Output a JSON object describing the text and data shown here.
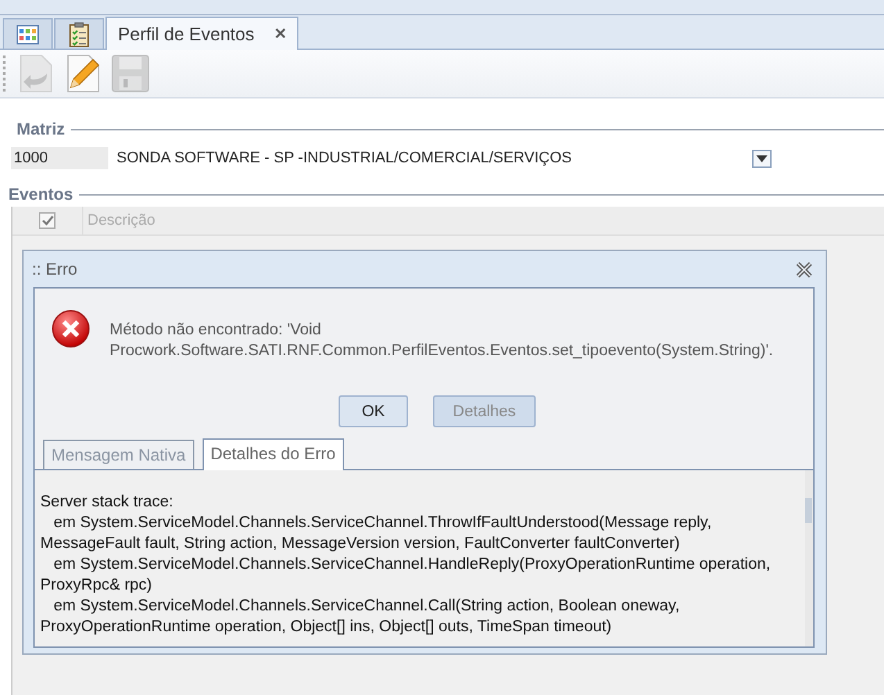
{
  "doc_tabs": [
    {
      "kind": "grid",
      "selected": false
    },
    {
      "kind": "checklist",
      "selected": false
    },
    {
      "kind": "text",
      "label": "Perfil de Eventos",
      "close": "✕",
      "selected": true
    }
  ],
  "toolbar": [
    {
      "kind": "undo",
      "disabled": true
    },
    {
      "kind": "edit",
      "disabled": false
    },
    {
      "kind": "save",
      "disabled": true
    }
  ],
  "matriz": {
    "title": "Matriz",
    "code": "1000",
    "name": "SONDA SOFTWARE - SP -INDUSTRIAL/COMERCIAL/SERVIÇOS"
  },
  "eventos": {
    "title": "Eventos",
    "header_checked": true,
    "column": "Descrição"
  },
  "dialog": {
    "title": ":: Erro",
    "message": "Método não encontrado: 'Void\nProcwork.Software.SATI.RNF.Common.PerfilEventos.Eventos.set_tipoevento(System.String)'.",
    "buttons": [
      {
        "label": "OK",
        "disabled": false
      },
      {
        "label": "Detalhes",
        "disabled": true
      }
    ],
    "tabs": [
      {
        "label": "Mensagem Nativa",
        "selected": false
      },
      {
        "label": "Detalhes do Erro",
        "selected": true
      }
    ],
    "details": [
      "Server stack trace:",
      "   em System.ServiceModel.Channels.ServiceChannel.ThrowIfFaultUnderstood(Message reply,",
      "MessageFault fault, String action, MessageVersion version, FaultConverter faultConverter)",
      "   em System.ServiceModel.Channels.ServiceChannel.HandleReply(ProxyOperationRuntime operation,",
      "ProxyRpc& rpc)",
      "   em System.ServiceModel.Channels.ServiceChannel.Call(String action, Boolean oneway,",
      "ProxyOperationRuntime operation, Object[] ins, Object[] outs, TimeSpan timeout)"
    ]
  }
}
